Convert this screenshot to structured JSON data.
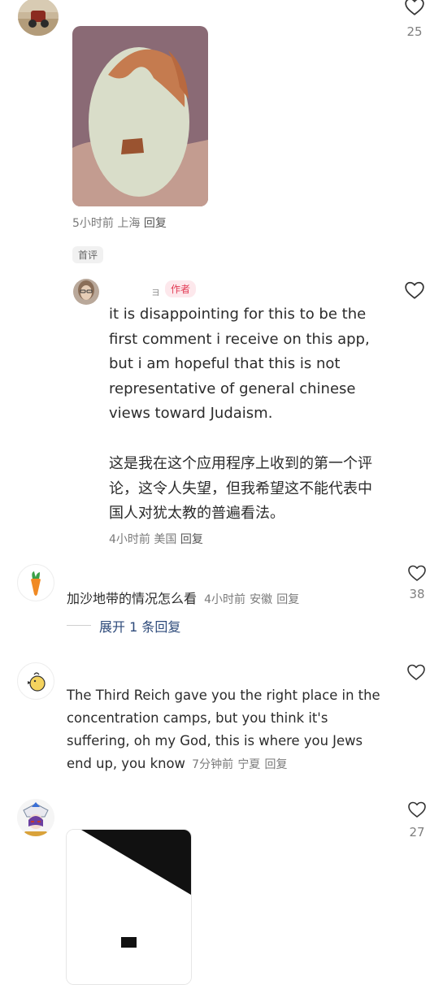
{
  "colors": {
    "accent": "#e23a54",
    "link": "#2d4a7a",
    "meta": "#7a7a7a"
  },
  "c1": {
    "like_count": "25",
    "time": "5小时前",
    "location": "上海",
    "reply_label": "回复",
    "first_tag": "首评"
  },
  "r1": {
    "username": "ョ",
    "author_tag": "作者",
    "text_en": "it is disappointing for this to be the first comment i receive on this app, but i am hopeful that this is not representative of general chinese views toward Judaism.",
    "text_zh": "这是我在这个应用程序上收到的第一个评论，这令人失望，但我希望这不能代表中国人对犹太教的普遍看法。",
    "time": "4小时前",
    "location": "美国",
    "reply_label": "回复"
  },
  "c2": {
    "text": "加沙地带的情况怎么看",
    "time": "4小时前",
    "location": "安徽",
    "reply_label": "回复",
    "like_count": "38",
    "expand_label": "展开 1 条回复"
  },
  "c3": {
    "text": "The Third Reich gave you the right place in the concentration camps, but you think it's suffering, oh my God, this is where you Jews end up, you know",
    "time": "7分钟前",
    "location": "宁夏",
    "reply_label": "回复"
  },
  "c4": {
    "like_count": "27"
  },
  "icons": {
    "like": "heart-outline-icon"
  }
}
